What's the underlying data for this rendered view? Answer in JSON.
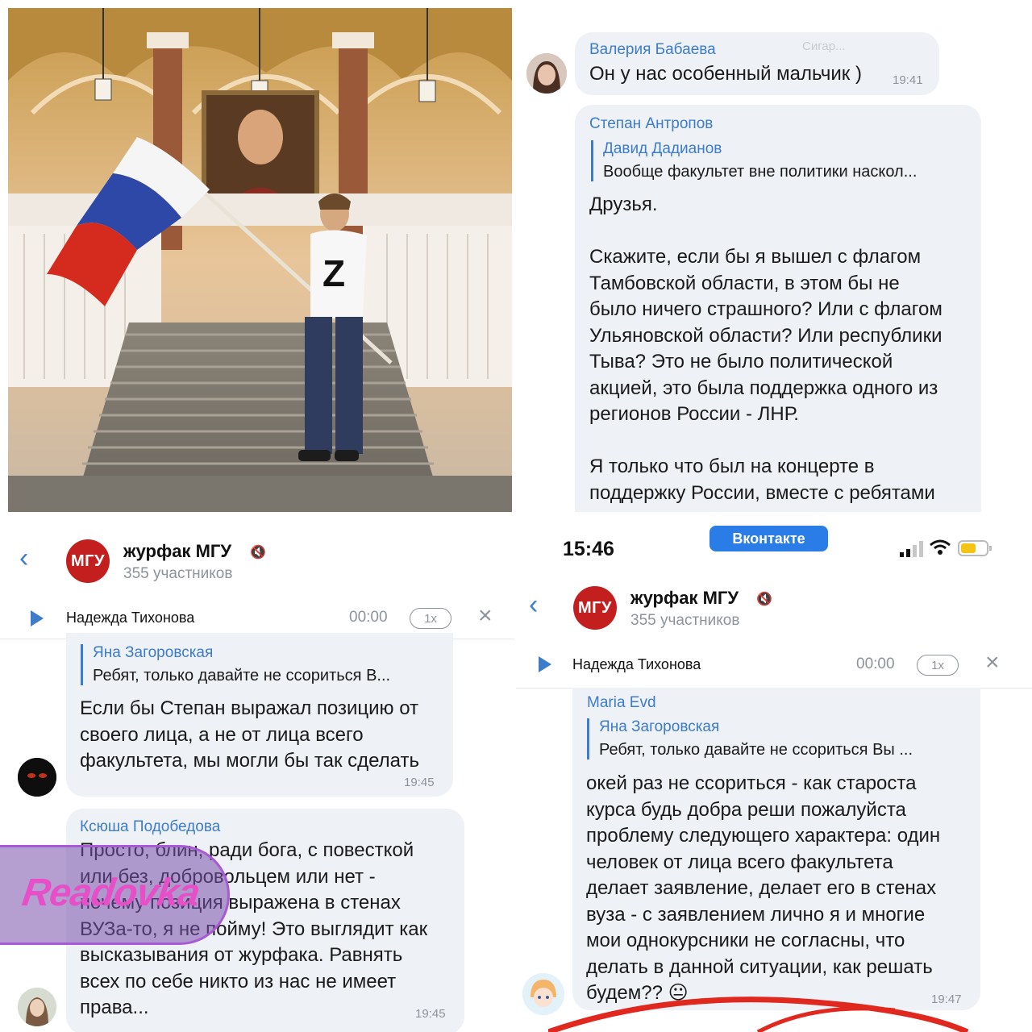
{
  "top_right": {
    "m1": {
      "sender": "Валерия Бабаева",
      "ghost": "Сигар...",
      "text": "Он у нас особенный мальчик )",
      "time": "19:41"
    },
    "m2": {
      "sender": "Степан Антропов",
      "quote_name": "Давид Дадианов",
      "quote_text": "Вообще факультет вне политики наскол...",
      "lines": [
        "Друзья.",
        "",
        "Скажите, если бы я вышел с флагом",
        "Тамбовской области, в этом бы не",
        "было ничего страшного? Или с флагом",
        "Ульяновской области? Или республики",
        "Тыва? Это не было политической",
        "акцией, это была поддержка одного из",
        "регионов России - ЛНР.",
        "",
        "Я только что был на концерте в",
        "поддержку России, вместе с ребятами"
      ]
    }
  },
  "bottom_left": {
    "header": {
      "title": "журфак МГУ",
      "subtitle": "355 участников",
      "logo": "МГУ"
    },
    "player": {
      "name": "Надежда Тихонова",
      "time": "00:00",
      "speed": "1x"
    },
    "m1": {
      "quote_name": "Яна Загоровская",
      "quote_text": "Ребят, только давайте не ссориться В...",
      "lines": [
        "Если бы Степан выражал позицию от",
        "своего лица, а не от лица всего",
        "факультета, мы могли бы так сделать"
      ],
      "time": "19:45"
    },
    "m2": {
      "sender": "Ксюша Подобедова",
      "lines": [
        "Просто, блин, ради бога, с повесткой",
        "или без, добровольцем или нет -",
        "почему позиция выражена в стенах",
        "ВУЗа-то, я не пойму! Это выглядит как",
        "высказывания от журфака. Равнять",
        "всех по себе никто из нас не имеет",
        "права..."
      ],
      "time": "19:45"
    },
    "watermark": "Readovka"
  },
  "bottom_right": {
    "status": {
      "clock": "15:46",
      "pill": "Вконтакте"
    },
    "header": {
      "title": "журфак МГУ",
      "subtitle": "355 участников",
      "logo": "МГУ"
    },
    "player": {
      "name": "Надежда Тихонова",
      "time": "00:00",
      "speed": "1x"
    },
    "m1": {
      "sender": "Maria Evd",
      "quote_name": "Яна Загоровская",
      "quote_text": "Ребят, только давайте не ссориться Вы ...",
      "lines": [
        "окей раз не ссориться - как староста",
        "курса будь добра реши пожалуйста",
        "проблему следующего характера: один",
        "человек от лица всего факультета",
        "делает заявление, делает его в стенах",
        "вуза - с заявлением лично я и многие",
        "мои однокурсники не согласны, что",
        "делать в данной ситуации, как решать",
        "будем?? 😐"
      ],
      "time": "19:47"
    }
  },
  "colors": {
    "accent": "#3d7cc9",
    "bubble": "#eef1f6",
    "logo_red": "#c41f1f",
    "watermark": "#e64fc8"
  }
}
